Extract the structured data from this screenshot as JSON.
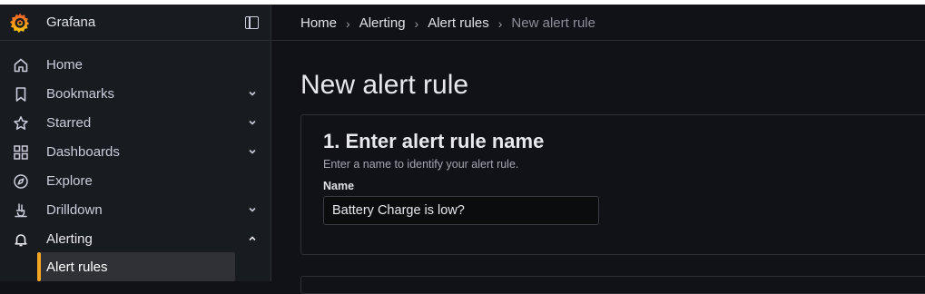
{
  "app": {
    "brand": "Grafana",
    "accent_color": "#f5a623",
    "logo_icon": "grafana-logo-icon",
    "dock_icon": "dock-menu-icon"
  },
  "sidebar": {
    "items": [
      {
        "label": "Home",
        "icon": "home-icon",
        "expandable": false
      },
      {
        "label": "Bookmarks",
        "icon": "bookmark-icon",
        "expandable": true,
        "expanded": false
      },
      {
        "label": "Starred",
        "icon": "star-icon",
        "expandable": true,
        "expanded": false
      },
      {
        "label": "Dashboards",
        "icon": "apps-icon",
        "expandable": true,
        "expanded": false
      },
      {
        "label": "Explore",
        "icon": "compass-icon",
        "expandable": false
      },
      {
        "label": "Drilldown",
        "icon": "drilldown-icon",
        "expandable": true,
        "expanded": false
      },
      {
        "label": "Alerting",
        "icon": "bell-icon",
        "expandable": true,
        "expanded": true
      }
    ],
    "subitems": [
      {
        "label": "Alert rules",
        "active": true
      }
    ]
  },
  "breadcrumb": {
    "items": [
      "Home",
      "Alerting",
      "Alert rules",
      "New alert rule"
    ]
  },
  "page": {
    "title": "New alert rule"
  },
  "section1": {
    "title": "1. Enter alert rule name",
    "description": "Enter a name to identify your alert rule.",
    "name_label": "Name",
    "name_value": "Battery Charge is low?"
  }
}
